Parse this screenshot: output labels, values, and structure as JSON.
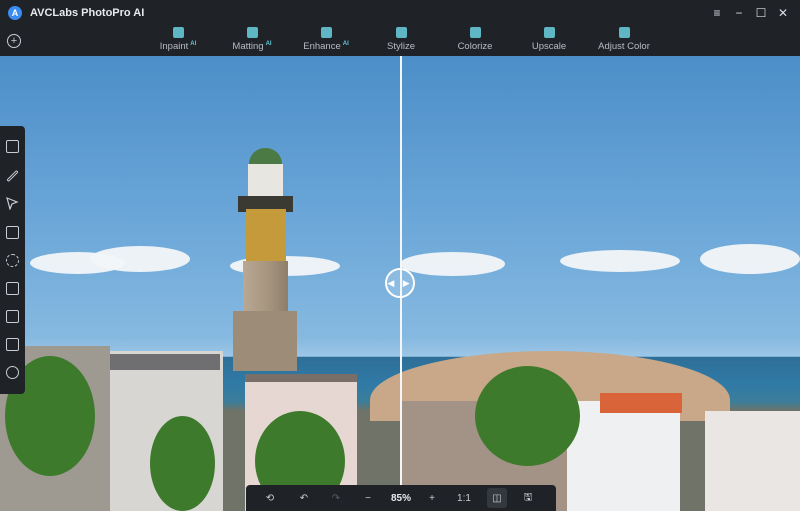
{
  "app": {
    "title": "AVCLabs PhotoPro AI",
    "logo_letter": "A"
  },
  "window_controls": {
    "menu": "≡",
    "minimize": "−",
    "maximize": "☐",
    "close": "✕"
  },
  "toolbar": {
    "add_label": "+",
    "tools": [
      {
        "label": "Inpaint",
        "ai": "AI",
        "icon": "inpaint-icon"
      },
      {
        "label": "Matting",
        "ai": "AI",
        "icon": "matting-icon"
      },
      {
        "label": "Enhance",
        "ai": "AI",
        "icon": "enhance-icon"
      },
      {
        "label": "Stylize",
        "ai": "",
        "icon": "stylize-icon"
      },
      {
        "label": "Colorize",
        "ai": "",
        "icon": "colorize-icon"
      },
      {
        "label": "Upscale",
        "ai": "",
        "icon": "upscale-icon"
      },
      {
        "label": "Adjust Color",
        "ai": "",
        "icon": "adjust-color-icon"
      }
    ]
  },
  "compare": {
    "handle_glyph": "◀ ▶"
  },
  "bottom_bar": {
    "reset": "⟲",
    "undo": "↶",
    "redo": "↷",
    "zoom_out": "−",
    "zoom_value": "85%",
    "zoom_in": "+",
    "actual_size": "1:1",
    "compare_icon": "◫",
    "save_icon": "🖫"
  },
  "colors": {
    "accent": "#5ec8d8",
    "bg": "#1f2227"
  }
}
